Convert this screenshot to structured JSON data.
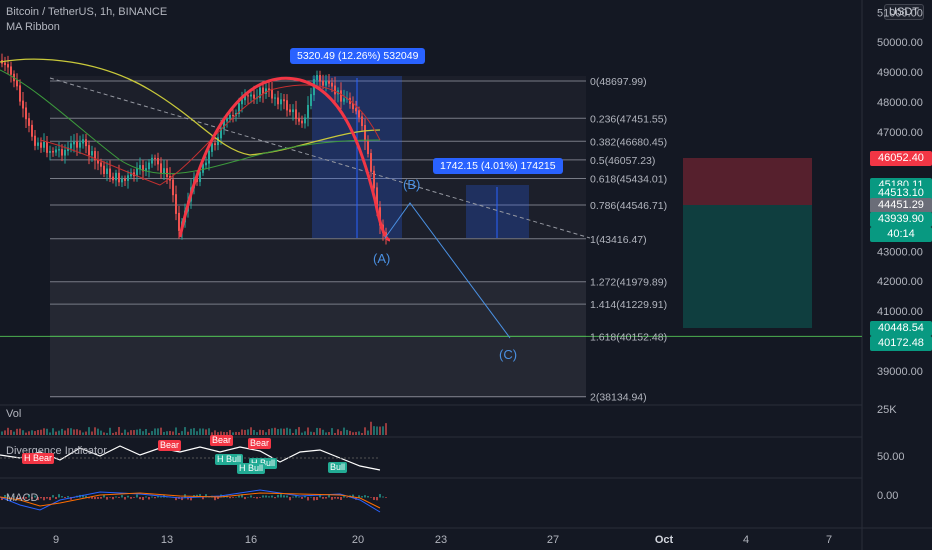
{
  "header": {
    "symbol": "Bitcoin / TetherUS, 1h, BINANCE",
    "indicator": "MA Ribbon",
    "currency": "USDT"
  },
  "chart_data": {
    "type": "candlestick",
    "y_ticks": [
      "51000.00",
      "50000.00",
      "49000.00",
      "48000.00",
      "47000.00",
      "43000.00",
      "42000.00",
      "41000.00",
      "39000.00"
    ],
    "x_ticks": [
      "9",
      "13",
      "16",
      "20",
      "23",
      "27",
      "Oct",
      "4",
      "7"
    ],
    "price_badges": [
      {
        "value": "46052.40",
        "color": "#f23645"
      },
      {
        "value": "45180.11",
        "color": "#089981"
      },
      {
        "value": "44513.10",
        "color": "#089981"
      },
      {
        "value": "44451.29",
        "color": "#6a6d78"
      },
      {
        "value": "43939.90",
        "color": "#089981"
      },
      {
        "value": "40:14",
        "color": "#089981"
      },
      {
        "value": "40448.54",
        "color": "#089981"
      },
      {
        "value": "40172.48",
        "color": "#089981"
      }
    ],
    "fib_levels": [
      {
        "label": "0(48697.99)",
        "price": 48697.99
      },
      {
        "label": "0.236(47451.55)",
        "price": 47451.55
      },
      {
        "label": "0.382(46680.45)",
        "price": 46680.45
      },
      {
        "label": "0.5(46057.23)",
        "price": 46057.23
      },
      {
        "label": "0.618(45434.01)",
        "price": 45434.01
      },
      {
        "label": "0.786(44546.71)",
        "price": 44546.71
      },
      {
        "label": "1(43416.47)",
        "price": 43416.47
      },
      {
        "label": "1.272(41979.89)",
        "price": 41979.89
      },
      {
        "label": "1.414(41229.91)",
        "price": 41229.91
      },
      {
        "label": "1.618(40152.48)",
        "price": 40152.48
      },
      {
        "label": "2(38134.94)",
        "price": 38134.94
      }
    ],
    "annotations": {
      "measure1": "5320.49 (12.26%) 532049",
      "measure2": "1742.15 (4.01%) 174215",
      "waveA": "(A)",
      "waveB": "(B)",
      "waveC": "(C)"
    }
  },
  "panes": {
    "vol": {
      "label": "Vol",
      "scale": "25K"
    },
    "divergence": {
      "label": "Divergence Indicator",
      "scale": "50.00",
      "tags": [
        {
          "text": "H Bear",
          "color": "#f23645"
        },
        {
          "text": "Bear",
          "color": "#f23645"
        },
        {
          "text": "Bear",
          "color": "#f23645"
        },
        {
          "text": "Bear",
          "color": "#f23645"
        },
        {
          "text": "H Bull",
          "color": "#22ab94"
        },
        {
          "text": "H Bull",
          "color": "#22ab94"
        },
        {
          "text": "H Bull",
          "color": "#22ab94"
        },
        {
          "text": "Bull",
          "color": "#22ab94"
        }
      ]
    },
    "macd": {
      "label": "MACD",
      "scale": "0.00"
    }
  }
}
